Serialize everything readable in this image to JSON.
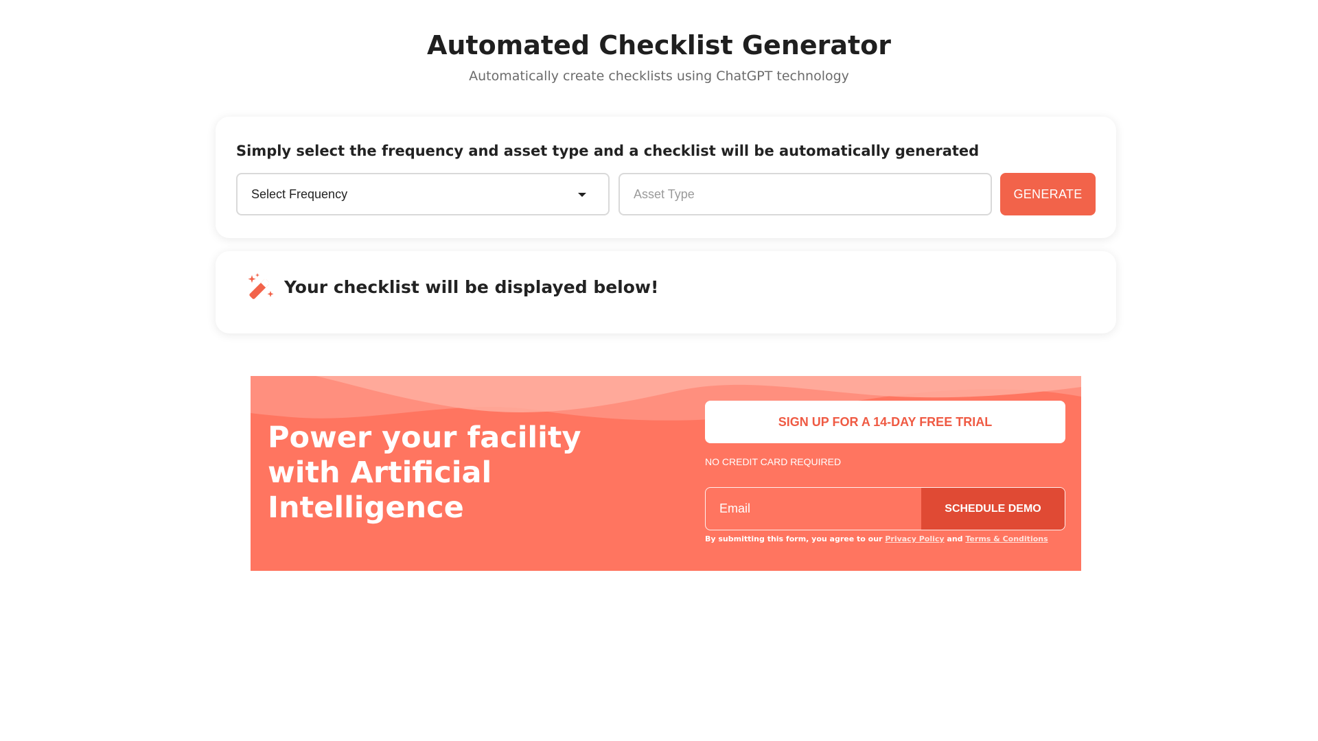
{
  "header": {
    "title": "Automated Checklist Generator",
    "subtitle": "Automatically create checklists using ChatGPT technology"
  },
  "form": {
    "instruction": "Simply select the frequency and asset type and a checklist will be automatically generated",
    "frequency_select_value": "Select Frequency",
    "asset_type_placeholder": "Asset Type",
    "asset_type_value": "",
    "generate_label": "GENERATE"
  },
  "result": {
    "icon": "magic-wand-icon",
    "message": "Your checklist will be displayed below!"
  },
  "promo": {
    "headline": "Power your facility with Artificial Intelligence",
    "trial_label": "SIGN UP FOR A 14-DAY FREE TRIAL",
    "no_card_note": "NO CREDIT CARD REQUIRED",
    "email_placeholder": "Email",
    "schedule_label": "SCHEDULE DEMO",
    "consent_prefix": "By submitting this form, you agree to our",
    "privacy_link": "Privacy Policy",
    "consent_and": "and",
    "terms_link": "Terms & Conditions"
  },
  "colors": {
    "accent": "#f2634a",
    "promo_background": "#ff7560",
    "schedule_button": "#e04a34",
    "subtitle_text": "#6b6b6b"
  }
}
